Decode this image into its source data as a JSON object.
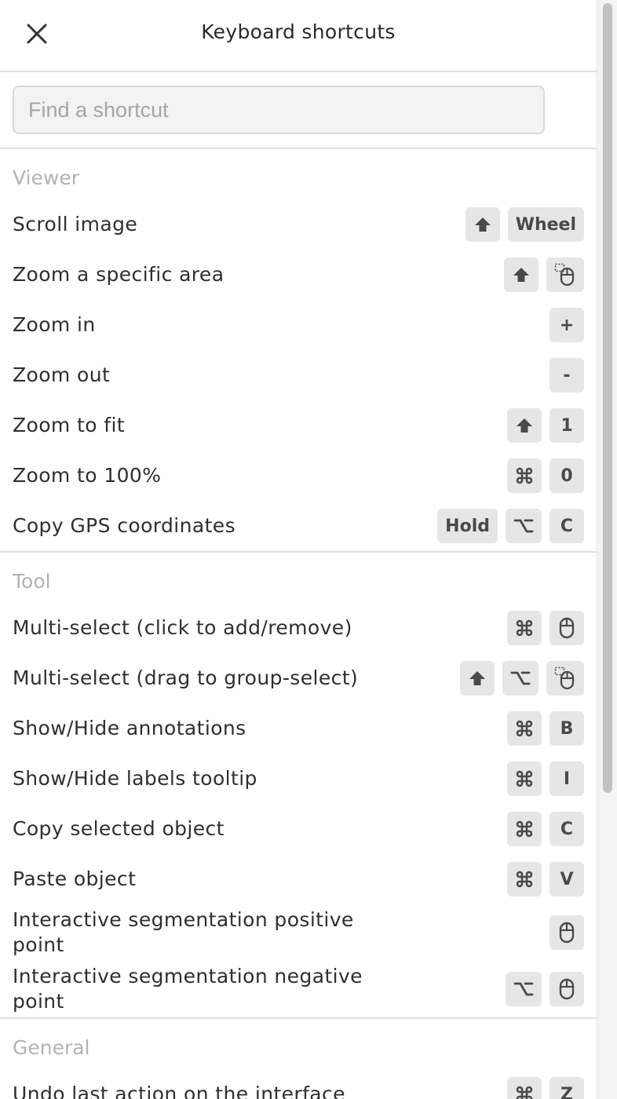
{
  "header": {
    "title": "Keyboard shortcuts"
  },
  "search": {
    "placeholder": "Find a shortcut",
    "value": ""
  },
  "sections": [
    {
      "title": "Viewer",
      "rows": [
        {
          "label": "Scroll image",
          "keys": [
            {
              "icon": "shift-icon"
            },
            {
              "text": "Wheel"
            }
          ]
        },
        {
          "label": "Zoom a specific area",
          "keys": [
            {
              "icon": "shift-icon"
            },
            {
              "icon": "mouse-drag-icon"
            }
          ]
        },
        {
          "label": "Zoom in",
          "keys": [
            {
              "text": "+"
            }
          ]
        },
        {
          "label": "Zoom out",
          "keys": [
            {
              "text": "-"
            }
          ]
        },
        {
          "label": "Zoom to fit",
          "keys": [
            {
              "icon": "shift-icon"
            },
            {
              "text": "1"
            }
          ]
        },
        {
          "label": "Zoom to 100%",
          "keys": [
            {
              "icon": "command-icon"
            },
            {
              "text": "0"
            }
          ]
        },
        {
          "label": "Copy GPS coordinates",
          "keys": [
            {
              "text": "Hold"
            },
            {
              "icon": "option-icon"
            },
            {
              "text": "C"
            }
          ]
        }
      ]
    },
    {
      "title": "Tool",
      "rows": [
        {
          "label": "Multi-select (click to add/remove)",
          "keys": [
            {
              "icon": "command-icon"
            },
            {
              "icon": "mouse-icon"
            }
          ]
        },
        {
          "label": "Multi-select (drag to group-select)",
          "keys": [
            {
              "icon": "shift-icon"
            },
            {
              "icon": "option-icon"
            },
            {
              "icon": "mouse-drag-icon"
            }
          ]
        },
        {
          "label": "Show/Hide annotations",
          "keys": [
            {
              "icon": "command-icon"
            },
            {
              "text": "B"
            }
          ]
        },
        {
          "label": "Show/Hide labels tooltip",
          "keys": [
            {
              "icon": "command-icon"
            },
            {
              "text": "I"
            }
          ]
        },
        {
          "label": "Copy selected object",
          "keys": [
            {
              "icon": "command-icon"
            },
            {
              "text": "C"
            }
          ]
        },
        {
          "label": "Paste object",
          "keys": [
            {
              "icon": "command-icon"
            },
            {
              "text": "V"
            }
          ]
        },
        {
          "label": "Interactive segmentation positive point",
          "keys": [
            {
              "icon": "mouse-icon"
            }
          ]
        },
        {
          "label": "Interactive segmentation negative point",
          "keys": [
            {
              "icon": "option-icon"
            },
            {
              "icon": "mouse-icon"
            }
          ]
        }
      ]
    },
    {
      "title": "General",
      "rows": [
        {
          "label": "Undo last action on the interface",
          "keys": [
            {
              "icon": "command-icon"
            },
            {
              "text": "Z"
            }
          ]
        }
      ]
    }
  ]
}
